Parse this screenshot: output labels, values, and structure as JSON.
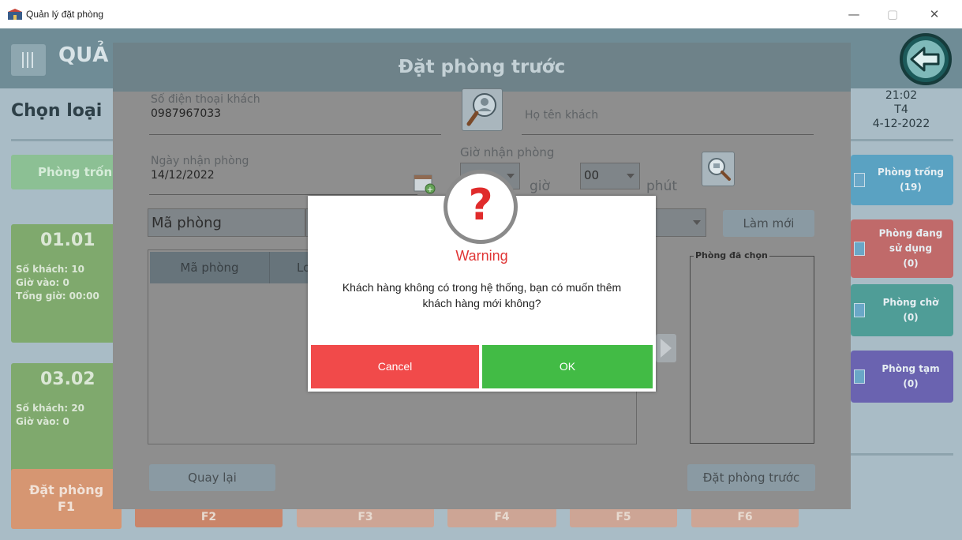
{
  "window": {
    "title": "Quản lý đặt phòng",
    "minimize_glyph": "—",
    "maximize_glyph": "▢",
    "close_glyph": "✕"
  },
  "header": {
    "app_title": "QUẢ",
    "section_title": "Chọn loại",
    "clock_time": "21:02",
    "clock_day": "T4",
    "clock_date": "4-12-2022"
  },
  "filter": {
    "empty_rooms_label": "Phòng trốn"
  },
  "rooms": [
    {
      "code": "01.01",
      "guests": "Số khách: 10",
      "checkin": "Giờ vào: 0",
      "total": "Tổng giờ: 00:00"
    },
    {
      "code": "03.02",
      "guests": "Số khách: 20",
      "checkin": "Giờ vào: 0",
      "total": ""
    }
  ],
  "legend": [
    {
      "label": "Phòng trống",
      "count": "(19)",
      "color": "#5aa2c2"
    },
    {
      "label": "Phòng đang sử dụng",
      "count": "(0)",
      "color": "#c06a6a"
    },
    {
      "label": "Phòng chờ",
      "count": "(0)",
      "color": "#4f9d97"
    },
    {
      "label": "Phòng tạm",
      "count": "(0)",
      "color": "#6a63b0"
    }
  ],
  "bottom_bar": {
    "book_label": "Đặt phòng",
    "book_key": "F1",
    "keys": [
      "F2",
      "F3",
      "F4",
      "F5",
      "F6"
    ]
  },
  "dialog": {
    "title": "Đặt phòng trước",
    "phone_label": "Số điện thoại khách",
    "phone_value": "0987967033",
    "name_placeholder": "Họ tên khách",
    "date_label": "Ngày nhận phòng",
    "date_value": "14/12/2022",
    "time_label": "Giờ nhận phòng",
    "hour_unit": "giờ",
    "minute_value": "00",
    "minute_unit": "phút",
    "room_code_placeholder": "Mã phòng",
    "refresh_label": "Làm mới",
    "table_columns": [
      "Mã phòng",
      "Lo"
    ],
    "selected_title": "Phòng đã chọn",
    "back_label": "Quay lại",
    "book_ahead_label": "Đặt phòng trước"
  },
  "warning": {
    "icon": "?",
    "title": "Warning",
    "message_line1": "Khách hàng không có trong hệ thống, bạn có muốn thêm",
    "message_line2": "khách hàng mới không?",
    "cancel_label": "Cancel",
    "ok_label": "OK",
    "cancel_color": "#f14a4a",
    "ok_color": "#42bb45"
  }
}
